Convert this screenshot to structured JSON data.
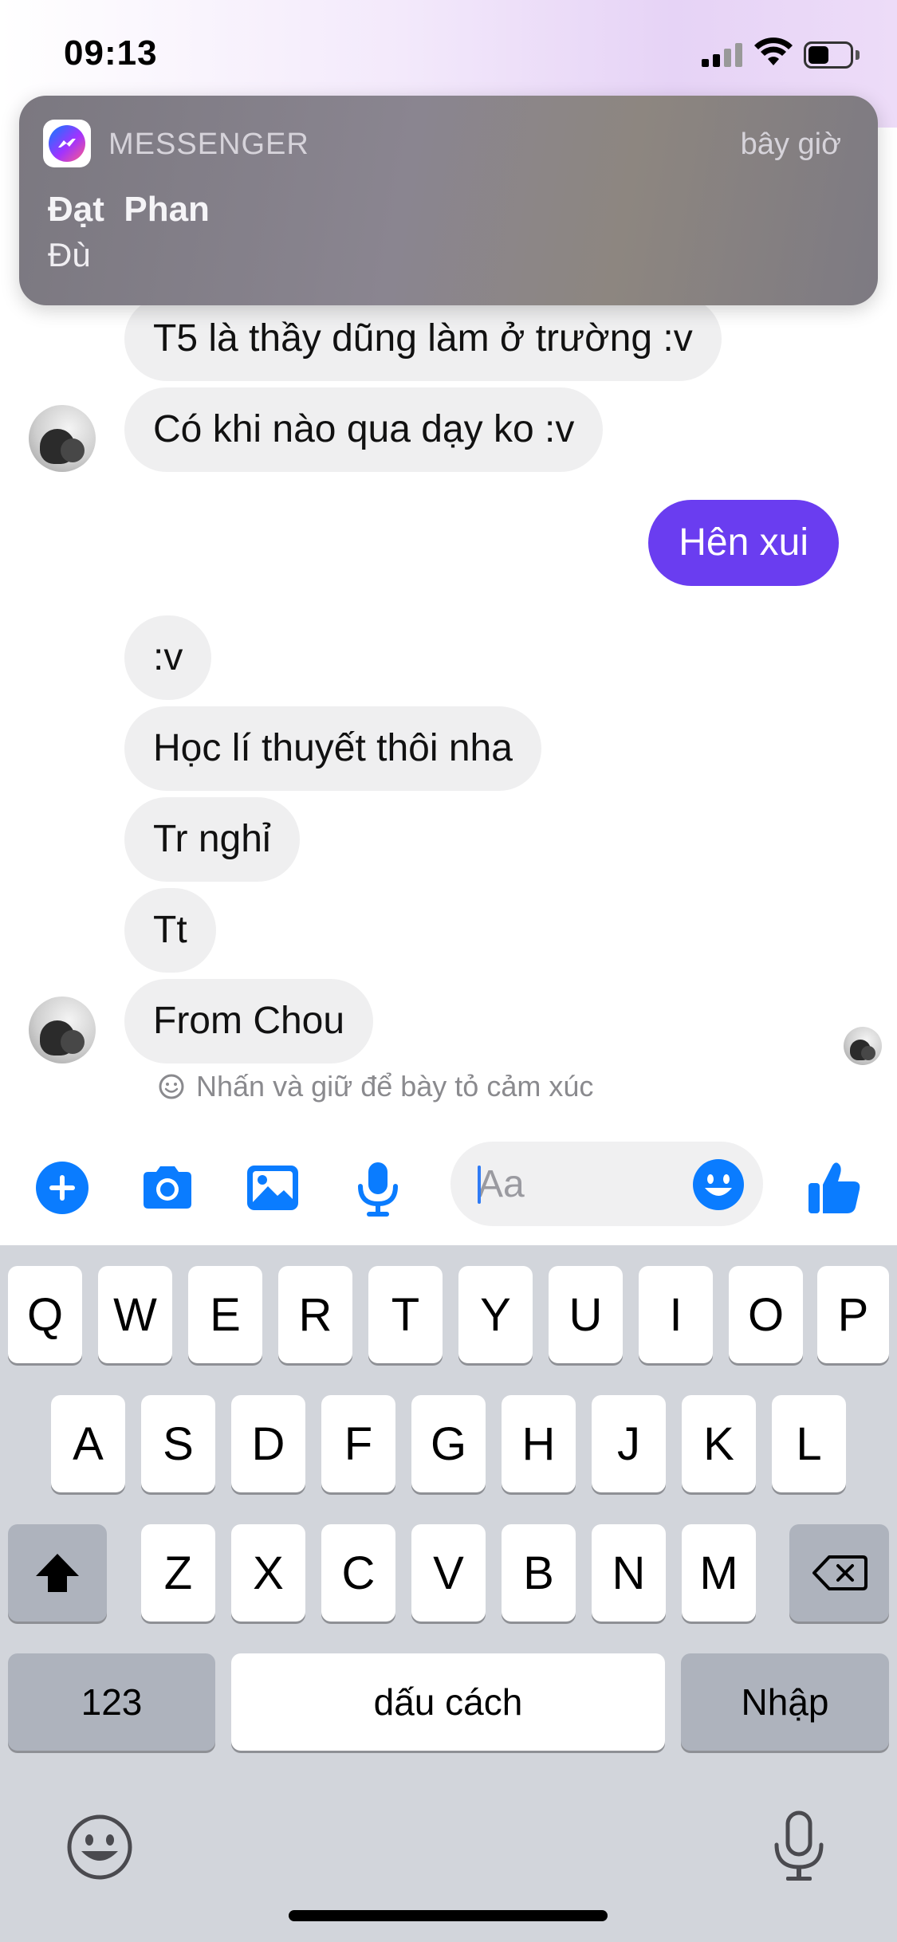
{
  "status_bar": {
    "time": "09:13",
    "battery_level": 0.5
  },
  "notification": {
    "app_name": "MESSENGER",
    "time": "bây giờ",
    "title": "Đạt  Phan",
    "body": "Đù"
  },
  "messages": [
    {
      "text": "T5 là thầy dũng làm ở trường :v",
      "direction": "incoming"
    },
    {
      "text": "Có khi nào qua dạy ko :v",
      "direction": "incoming"
    },
    {
      "text": "Hên xui",
      "direction": "outgoing"
    },
    {
      "text": ":v",
      "direction": "incoming"
    },
    {
      "text": "Học lí thuyết thôi nha",
      "direction": "incoming"
    },
    {
      "text": "Tr nghỉ",
      "direction": "incoming"
    },
    {
      "text": "Tt",
      "direction": "incoming"
    },
    {
      "text": "From Chou",
      "direction": "incoming"
    }
  ],
  "reaction_hint": "Nhấn và giữ để bày tỏ cảm xúc",
  "composer": {
    "placeholder": "Aa",
    "icons": [
      "plus-icon",
      "camera-icon",
      "gallery-icon",
      "microphone-icon",
      "emoji-icon",
      "like-icon"
    ]
  },
  "keyboard": {
    "row1": [
      "Q",
      "W",
      "E",
      "R",
      "T",
      "Y",
      "U",
      "I",
      "O",
      "P"
    ],
    "row2": [
      "A",
      "S",
      "D",
      "F",
      "G",
      "H",
      "J",
      "K",
      "L"
    ],
    "row3": [
      "Z",
      "X",
      "C",
      "V",
      "B",
      "N",
      "M"
    ],
    "numbers_label": "123",
    "space_label": "dấu cách",
    "return_label": "Nhập"
  },
  "colors": {
    "outgoing_bubble": "#6a3df0",
    "incoming_bubble": "#efeff0",
    "accent_blue": "#0a7cff"
  }
}
